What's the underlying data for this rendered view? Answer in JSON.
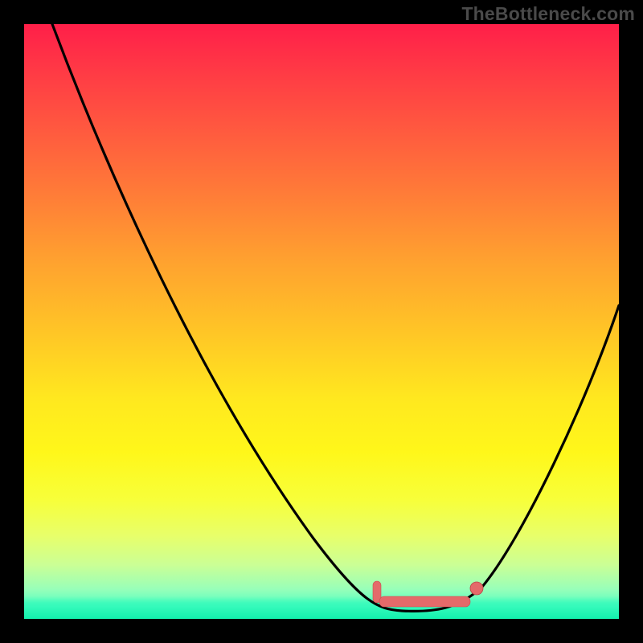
{
  "watermark": "TheBottleneck.com",
  "chart_data": {
    "type": "line",
    "title": "",
    "xlabel": "",
    "ylabel": "",
    "xlim": [
      0,
      100
    ],
    "ylim": [
      0,
      100
    ],
    "grid": false,
    "legend": false,
    "background": {
      "kind": "vertical-gradient",
      "stops": [
        {
          "pos": 0,
          "color": "#ff1f49"
        },
        {
          "pos": 20,
          "color": "#ff5a3f"
        },
        {
          "pos": 45,
          "color": "#ffb82a"
        },
        {
          "pos": 70,
          "color": "#fff71a"
        },
        {
          "pos": 90,
          "color": "#caff96"
        },
        {
          "pos": 100,
          "color": "#17f7b6"
        }
      ]
    },
    "series": [
      {
        "name": "bottleneck-curve",
        "color": "#000000",
        "x": [
          5,
          10,
          20,
          30,
          40,
          49,
          57,
          63,
          68,
          72,
          77,
          84,
          92,
          100
        ],
        "y": [
          100,
          88,
          66,
          48,
          30,
          14,
          4,
          1,
          0,
          1,
          5,
          18,
          38,
          53
        ]
      }
    ],
    "markers": [
      {
        "name": "optimal-range-start",
        "x": 59,
        "y": 3,
        "color": "#e46a6a"
      },
      {
        "name": "optimal-range-flat",
        "x": 67,
        "y": 1,
        "color": "#e46a6a"
      },
      {
        "name": "optimal-range-end",
        "x": 76,
        "y": 4,
        "color": "#e46a6a"
      }
    ],
    "annotations": [
      {
        "text": "TheBottleneck.com",
        "role": "watermark",
        "position": "top-right",
        "color": "#4a4a4a"
      }
    ]
  }
}
